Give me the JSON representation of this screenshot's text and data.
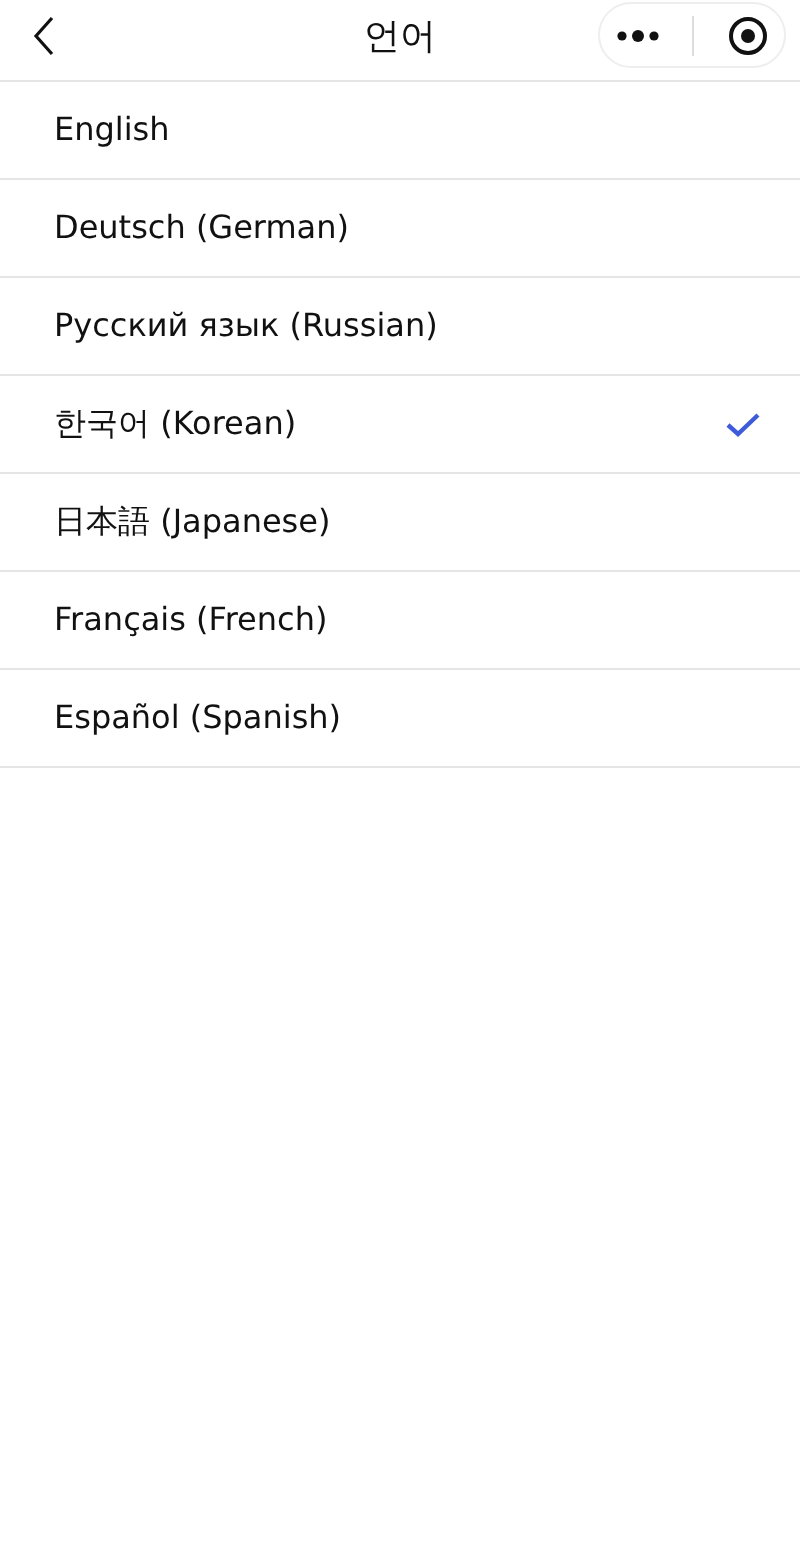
{
  "header": {
    "title": "언어"
  },
  "languages": [
    {
      "label": "English",
      "selected": false
    },
    {
      "label": "Deutsch (German)",
      "selected": false
    },
    {
      "label": "Русский язык (Russian)",
      "selected": false
    },
    {
      "label": "한국어 (Korean)",
      "selected": true
    },
    {
      "label": "日本語 (Japanese)",
      "selected": false
    },
    {
      "label": "Français (French)",
      "selected": false
    },
    {
      "label": "Español (Spanish)",
      "selected": false
    }
  ]
}
